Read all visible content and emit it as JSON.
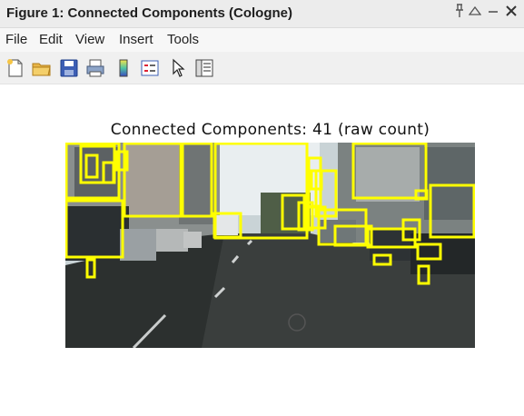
{
  "window": {
    "title": "Figure 1: Connected Components (Cologne)",
    "controls": {
      "pin_icon": "pin-icon",
      "dock_icon": "triangle-up-icon",
      "minimize_icon": "minimize-icon",
      "close_icon": "close-icon"
    }
  },
  "menu": {
    "items": [
      "File",
      "Edit",
      "View",
      "Insert",
      "Tools"
    ]
  },
  "toolbar": {
    "buttons": [
      "new-figure-icon",
      "open-file-icon",
      "save-icon",
      "print-icon",
      "colorbar-icon",
      "legend-icon",
      "pointer-icon",
      "property-inspector-icon"
    ]
  },
  "figure": {
    "plot_title": "Connected Components: 41 (raw count)",
    "box_color": "#ffff00"
  }
}
